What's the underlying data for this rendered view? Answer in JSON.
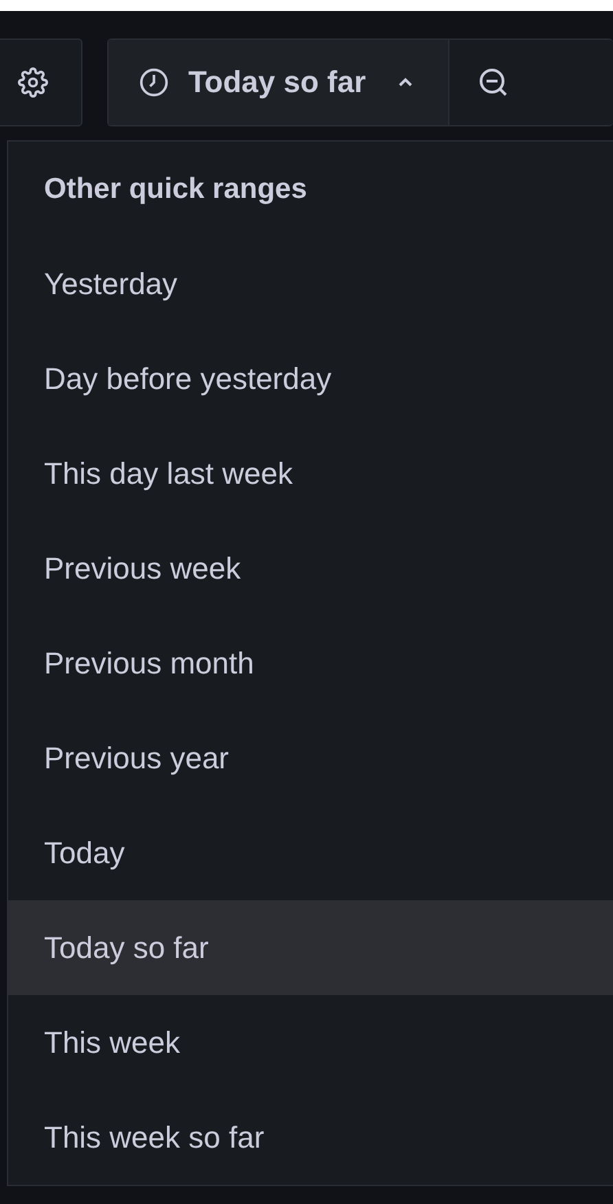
{
  "toolbar": {
    "time_picker": {
      "label": "Today so far",
      "expanded": true
    }
  },
  "menu": {
    "heading": "Other quick ranges",
    "items": [
      {
        "label": "Yesterday",
        "selected": false
      },
      {
        "label": "Day before yesterday",
        "selected": false
      },
      {
        "label": "This day last week",
        "selected": false
      },
      {
        "label": "Previous week",
        "selected": false
      },
      {
        "label": "Previous month",
        "selected": false
      },
      {
        "label": "Previous year",
        "selected": false
      },
      {
        "label": "Today",
        "selected": false
      },
      {
        "label": "Today so far",
        "selected": true
      },
      {
        "label": "This week",
        "selected": false
      },
      {
        "label": "This week so far",
        "selected": false
      }
    ]
  }
}
